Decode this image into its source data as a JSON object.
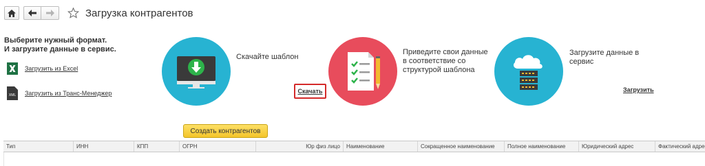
{
  "window": {
    "title": "Загрузка контрагентов"
  },
  "instructions": {
    "line1": "Выберите нужный формат.",
    "line2": "И загрузите данные в сервис."
  },
  "sources": [
    {
      "label": "Загрузить из Excel",
      "icon": "excel-icon"
    },
    {
      "label": "Загрузить из Транс-Менеджер",
      "icon": "xml-icon",
      "icon_text": "XML"
    }
  ],
  "steps": [
    {
      "text": "Скачайте шаблон",
      "link": "Скачать",
      "icon": "monitor-download-icon"
    },
    {
      "text_lines": [
        "Приведите свои данные",
        "в соответствие со",
        "структурой шаблона"
      ],
      "icon": "checklist-pencil-icon"
    },
    {
      "text_lines": [
        "Загрузите данные в",
        "сервис"
      ],
      "link": "Загрузить",
      "icon": "cloud-server-icon"
    }
  ],
  "create_button": "Создать контрагентов",
  "table": {
    "columns": [
      "Тип",
      "ИНН",
      "КПП",
      "ОГРН",
      "Юр физ лицо",
      "Наименование",
      "Сокращенное наименование",
      "Полное наименование",
      "Юридический адрес",
      "Фактический адрес"
    ]
  },
  "colors": {
    "accent_blue": "#27b3d2",
    "accent_red": "#e84c5c",
    "button_yellow": "#f4c52a",
    "highlight_red": "#d42a2a"
  }
}
